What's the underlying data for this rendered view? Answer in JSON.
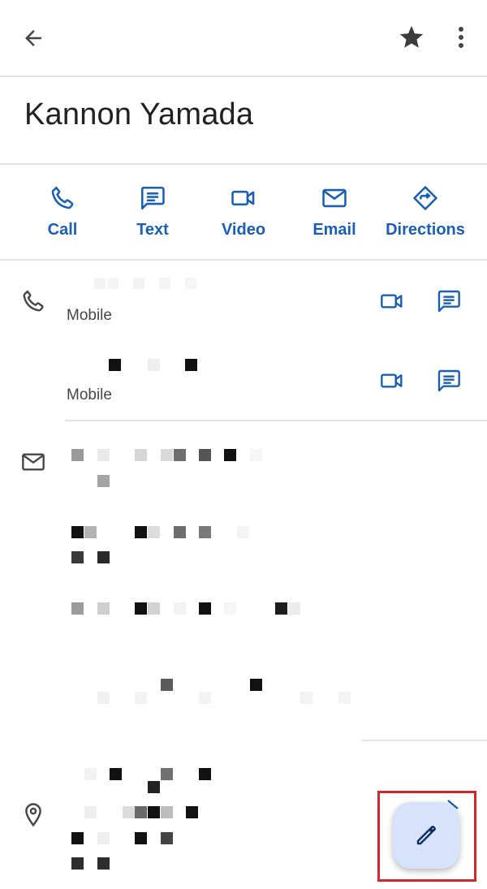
{
  "contact": {
    "name": "Kannon Yamada"
  },
  "actions": [
    {
      "label": "Call",
      "icon": "phone-icon"
    },
    {
      "label": "Text",
      "icon": "message-icon"
    },
    {
      "label": "Video",
      "icon": "videocam-icon"
    },
    {
      "label": "Email",
      "icon": "mail-icon"
    },
    {
      "label": "Directions",
      "icon": "directions-icon"
    }
  ],
  "phones": [
    {
      "type": "Mobile"
    },
    {
      "type": "Mobile"
    }
  ],
  "colors": {
    "accent": "#1a5fb4",
    "fab": "#d6e3fb",
    "highlight": "#d1262b"
  }
}
